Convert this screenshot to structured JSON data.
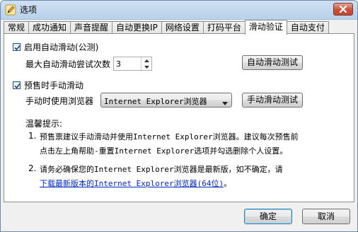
{
  "window": {
    "title": "选项"
  },
  "tabs": [
    {
      "label": "常规"
    },
    {
      "label": "成功通知"
    },
    {
      "label": "声音提醒"
    },
    {
      "label": "自动更换IP"
    },
    {
      "label": "网络设置"
    },
    {
      "label": "打码平台"
    },
    {
      "label": "滑动验证",
      "active": true
    },
    {
      "label": "自动支付"
    }
  ],
  "auto_slide": {
    "checkbox_label": "启用自动滑动(公测)",
    "checked": true,
    "max_attempts_label": "最大自动滑动尝试次数",
    "max_attempts_value": "3",
    "test_button": "自动滑动测试"
  },
  "manual_slide": {
    "checkbox_label": "预售时手动滑动",
    "checked": true,
    "browser_label": "手动时使用浏览器",
    "browser_value": "Internet Explorer浏览器",
    "test_button": "手动滑动测试"
  },
  "tips": {
    "heading": "温馨提示:",
    "item1_num": "1.",
    "item1_line1": "预售票建议手动滑动并使用Internet Explorer浏览器。建议每次预售前",
    "item1_line2": "点击左上角帮助-重置Internet Explorer选项并勾选删除个人设置。",
    "item2_num": "2.",
    "item2_line1": "请务必确保您的Internet Explorer浏览器是最新版，如不确定，请",
    "item2_link": "下载最新版本的Internet Explorer浏览器(64位)",
    "item2_suffix": "。"
  },
  "footer": {
    "ok_label": "确定",
    "cancel_label": "取消"
  },
  "icons": {
    "app": "pencil-icon",
    "close": "close-icon",
    "check": "check-icon",
    "spin_up": "spin-up-icon",
    "spin_down": "spin-down-icon",
    "dropdown": "chevron-down-icon"
  },
  "colors": {
    "close_button": "#c9503a",
    "link": "#0026c8",
    "default_button_border": "#3c7fb1"
  }
}
